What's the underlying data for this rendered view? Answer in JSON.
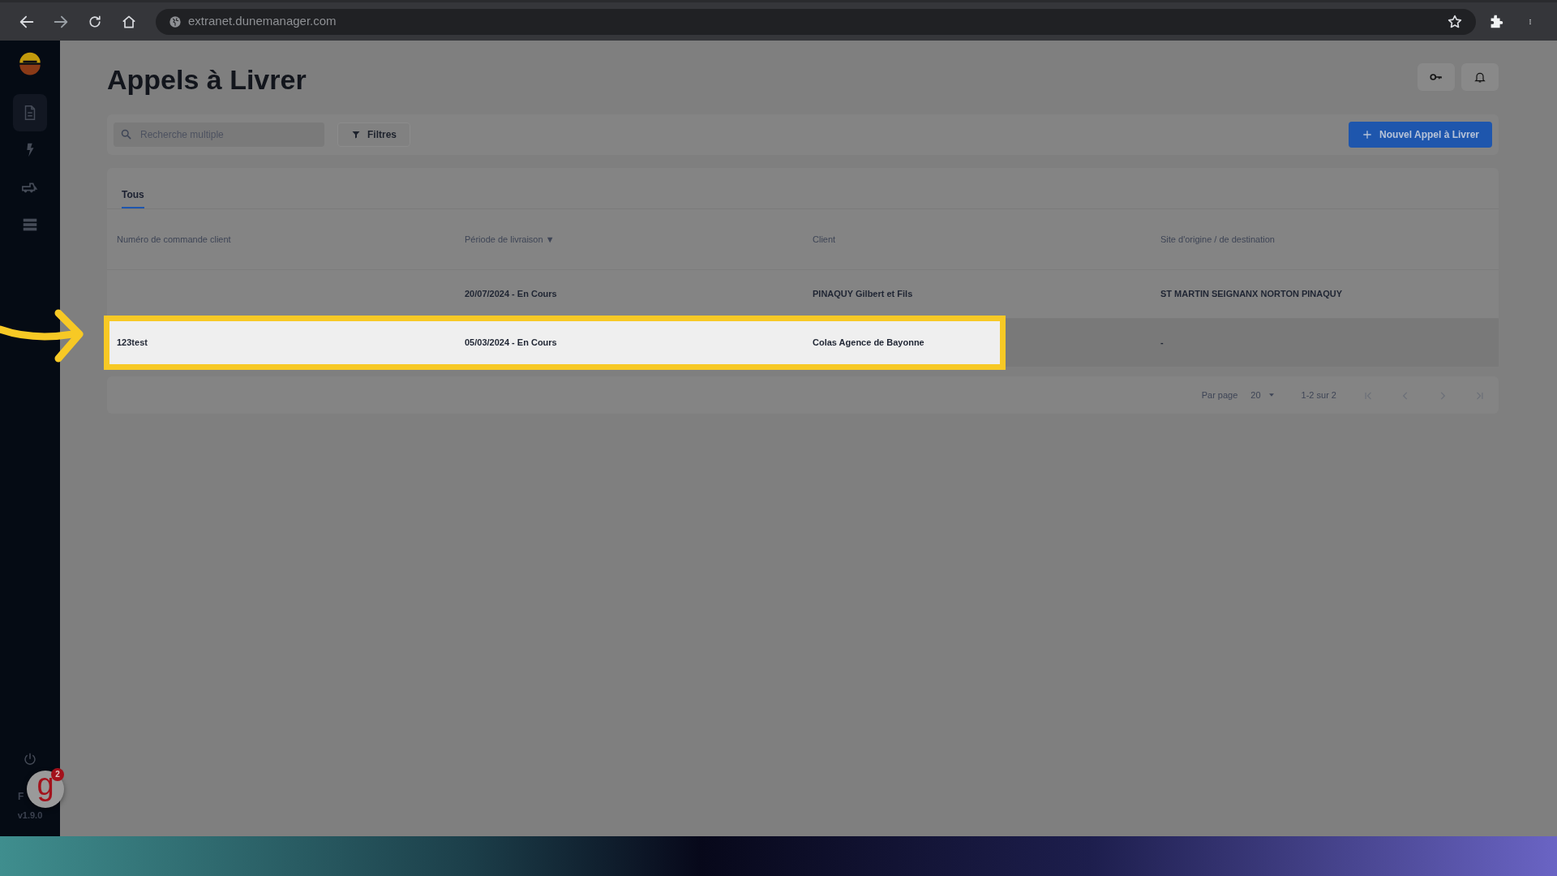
{
  "browser": {
    "url": "extranet.dunemanager.com"
  },
  "sidebar": {
    "items": [
      {
        "kind": "document",
        "selected": true
      },
      {
        "kind": "bolt",
        "selected": false
      },
      {
        "kind": "truck",
        "selected": false
      },
      {
        "kind": "list",
        "selected": false
      }
    ],
    "user_initials": "F",
    "version": "v1.9.0"
  },
  "page": {
    "title": "Appels à Livrer"
  },
  "toolbar": {
    "search": {
      "placeholder": "Recherche multiple"
    },
    "filter_button": "Filtres",
    "new_button": "Nouvel Appel à Livrer"
  },
  "tabs": [
    {
      "label": "Tous",
      "selected": true
    }
  ],
  "table": {
    "columns": [
      {
        "label": "Numéro de commande client"
      },
      {
        "label": "Période de livraison",
        "sort_indicator": "▼"
      },
      {
        "label": "Client"
      },
      {
        "label": "Site d'origine / de destination"
      }
    ],
    "rows": [
      {
        "cells": [
          "",
          "20/07/2024 - En Cours",
          "PINAQUY Gilbert et Fils",
          "ST MARTIN SEIGNANX NORTON PINAQUY"
        ],
        "highlighted": false
      },
      {
        "cells": [
          "123test",
          "05/03/2024 - En Cours",
          "Colas Agence de Bayonne",
          "-"
        ],
        "highlighted": true
      }
    ]
  },
  "pagination": {
    "per_page_label": "Par page",
    "per_page": "20",
    "range": "1-2 sur 2"
  },
  "widget": {
    "logo": "g",
    "badge": "2"
  }
}
